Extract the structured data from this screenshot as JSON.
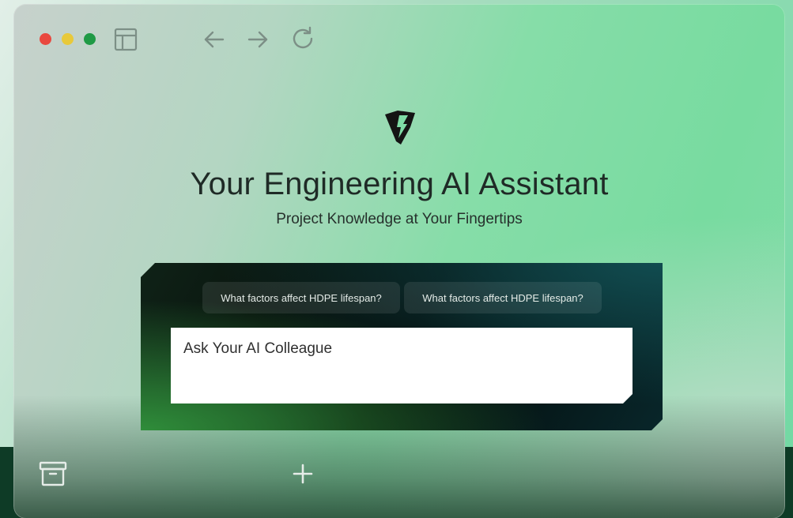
{
  "window": {
    "traffic_lights": {
      "close": "#e9483f",
      "minimize": "#e8c93a",
      "maximize": "#1f9a45"
    }
  },
  "toolbar": {
    "icons": [
      "sidebar-layout-icon",
      "back-arrow-icon",
      "forward-arrow-icon",
      "reload-icon"
    ]
  },
  "hero": {
    "logo": "lightning-shield-logo",
    "title": "Your Engineering AI Assistant",
    "subtitle": "Project Knowledge at Your Fingertips"
  },
  "chat": {
    "suggestions": [
      {
        "label": "What factors affect HDPE lifespan?"
      },
      {
        "label": "What factors affect HDPE lifespan?"
      }
    ],
    "input": {
      "placeholder": "Ask Your AI Colleague",
      "value": ""
    }
  },
  "dock": {
    "icons": [
      "archive-icon",
      "plus-icon"
    ]
  },
  "colors": {
    "accent": "#2f8d3a",
    "panel": "#040806",
    "text": "#1f2a26"
  }
}
